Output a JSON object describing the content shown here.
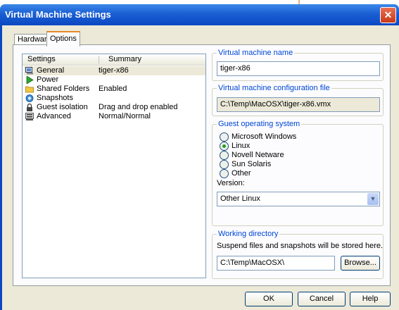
{
  "window": {
    "title": "Virtual Machine Settings",
    "close_glyph": "✕"
  },
  "tabs": [
    {
      "label": "Hardware"
    },
    {
      "label": "Options"
    }
  ],
  "settings_list": {
    "headers": {
      "settings": "Settings",
      "summary": "Summary"
    },
    "rows": [
      {
        "name": "General",
        "summary": "tiger-x86",
        "icon": "general-icon",
        "selected": true
      },
      {
        "name": "Power",
        "summary": "",
        "icon": "power-icon"
      },
      {
        "name": "Shared Folders",
        "summary": "Enabled",
        "icon": "folder-icon"
      },
      {
        "name": "Snapshots",
        "summary": "",
        "icon": "snapshot-icon"
      },
      {
        "name": "Guest isolation",
        "summary": "Drag and drop enabled",
        "icon": "lock-icon"
      },
      {
        "name": "Advanced",
        "summary": "Normal/Normal",
        "icon": "advanced-icon"
      }
    ]
  },
  "vm_name": {
    "legend": "Virtual machine name",
    "value": "tiger-x86"
  },
  "config_file": {
    "legend": "Virtual machine configuration file",
    "value": "C:\\Temp\\MacOSX\\tiger-x86.vmx"
  },
  "guest_os": {
    "legend": "Guest operating system",
    "options": [
      "Microsoft Windows",
      "Linux",
      "Novell Netware",
      "Sun Solaris",
      "Other"
    ],
    "selected": "Linux",
    "version_label": "Version:",
    "version_value": "Other Linux"
  },
  "working_dir": {
    "legend": "Working directory",
    "description": "Suspend files and snapshots will be stored here.",
    "value": "C:\\Temp\\MacOSX\\",
    "browse_label": "Browse..."
  },
  "buttons": {
    "ok": "OK",
    "cancel": "Cancel",
    "help": "Help"
  },
  "colors": {
    "title_bar": "#0b47c2",
    "legend_text": "#0046d5",
    "face": "#ece9d8",
    "tab_accent": "#e68b2c"
  }
}
